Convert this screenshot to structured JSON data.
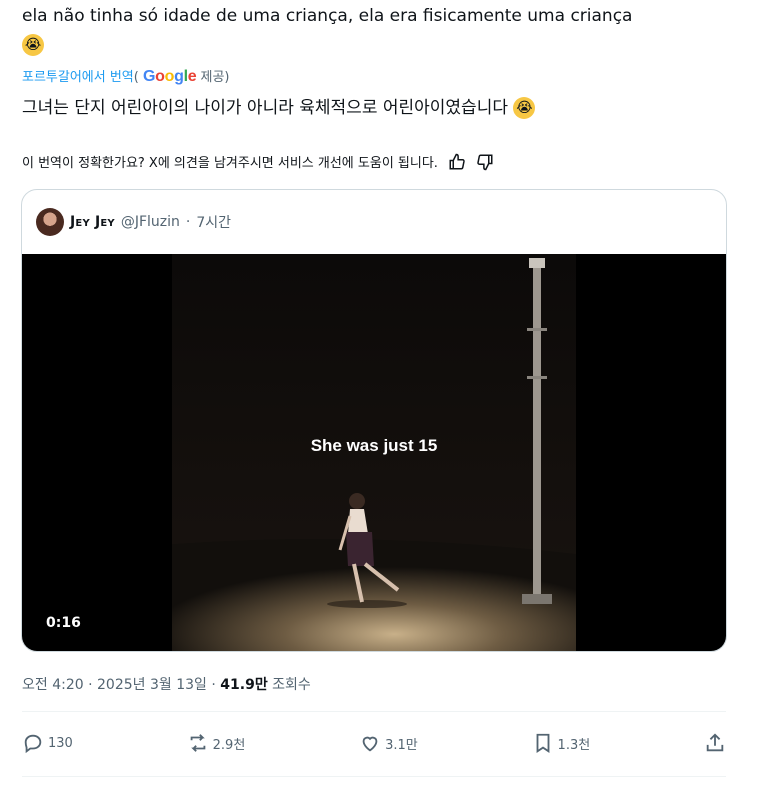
{
  "post": {
    "original_text": "ela não tinha só idade de uma criança, ela era fisicamente uma criança",
    "emoji": "😭",
    "translated_by_prefix": "포르투갈어에서 번역",
    "translated_by_open": "(",
    "translated_by_suffix": "제공)",
    "google_logo": [
      "G",
      "o",
      "o",
      "g",
      "l",
      "e"
    ],
    "translated_text": "그녀는 단지 어린아이의 나이가 아니라 육체적으로 어린아이였습니다",
    "feedback_prompt": "이 번역이 정확한가요? X에 의견을 남겨주시면 서비스 개선에 도움이 됩니다."
  },
  "quoted": {
    "name": "Jey Jey",
    "handle": "@JFluzin",
    "separator": "·",
    "time": "7시간",
    "video_caption": "She was just 15",
    "video_duration": "0:16"
  },
  "meta": {
    "time": "오전 4:20",
    "sep1": "·",
    "date": "2025년 3월 13일",
    "sep2": "·",
    "views": "41.9만",
    "views_label": "조회수"
  },
  "actions": {
    "replies": "130",
    "reposts": "2.9천",
    "likes": "3.1만",
    "bookmarks": "1.3천"
  },
  "colors": {
    "link": "#1d9bf0",
    "muted": "#536471",
    "border": "#cfd9de"
  }
}
